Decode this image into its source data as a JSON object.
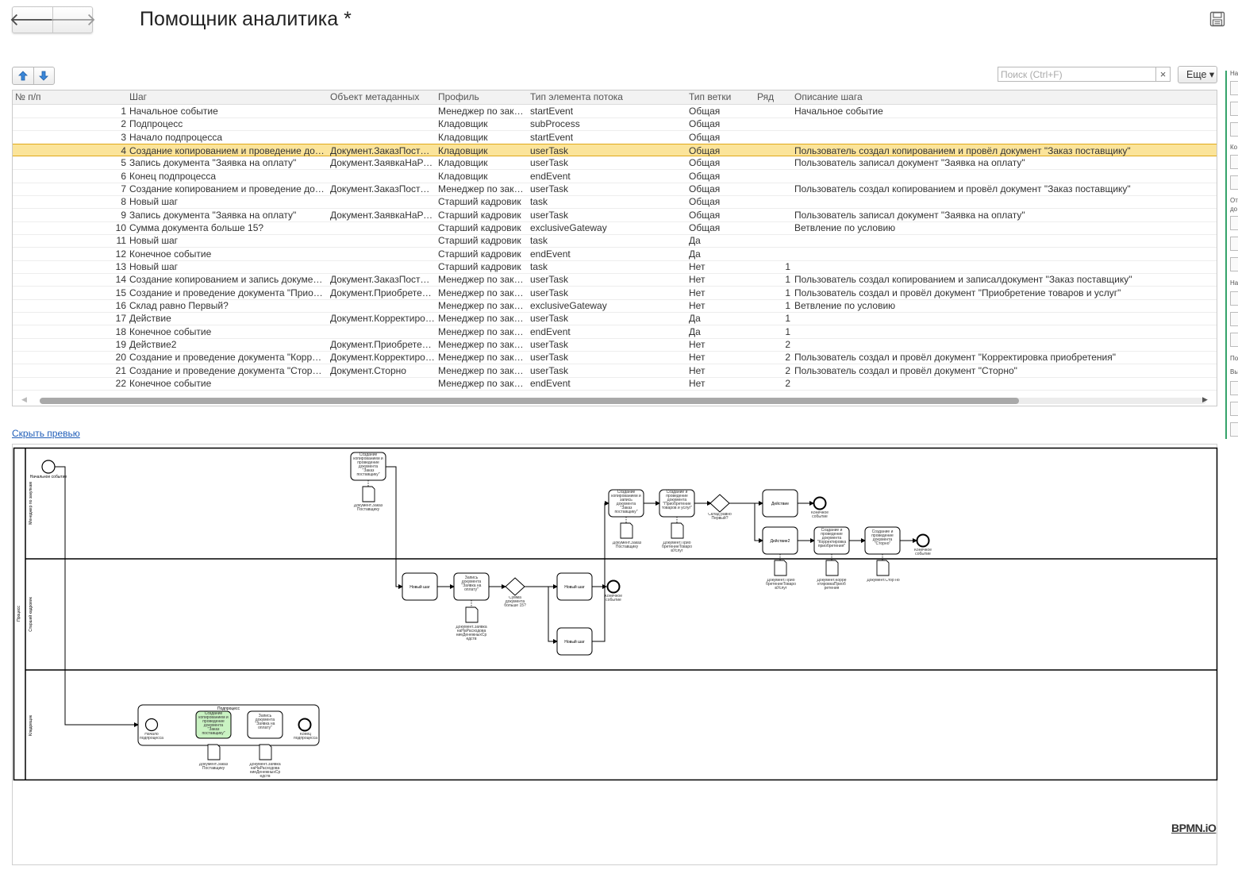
{
  "window": {
    "title": "Помощник аналитика *"
  },
  "nav": {
    "back": "🡐",
    "forward": "🡒"
  },
  "toolbar": {
    "search_placeholder": "Поиск (Ctrl+F)",
    "clear": "×",
    "more_label": "Еще ▾"
  },
  "table": {
    "columns": [
      "№ п/п",
      "Шаг",
      "Объект метаданных",
      "Профиль",
      "Тип элемента потока",
      "Тип ветки",
      "Ряд",
      "Описание шага"
    ],
    "rows": [
      {
        "n": "1",
        "step": "Начальное событие",
        "obj": "",
        "profile": "Менеджер по заку…",
        "type": "startEvent",
        "branch": "Общая",
        "row": "",
        "desc": "Начальное событие"
      },
      {
        "n": "2",
        "step": "Подпроцесс",
        "obj": "",
        "profile": "Кладовщик",
        "type": "subProcess",
        "branch": "Общая",
        "row": "",
        "desc": ""
      },
      {
        "n": "3",
        "step": "Начало подпроцесса",
        "obj": "",
        "profile": "Кладовщик",
        "type": "startEvent",
        "branch": "Общая",
        "row": "",
        "desc": ""
      },
      {
        "n": "4",
        "step": "Создание копированием и проведение доку…",
        "obj": "Документ.ЗаказПостав…",
        "profile": "Кладовщик",
        "type": "userTask",
        "branch": "Общая",
        "row": "",
        "desc": "Пользователь создал копированием и провёл документ \"Заказ поставщику\""
      },
      {
        "n": "5",
        "step": "Запись документа \"Заявка на оплату\"",
        "obj": "Документ.ЗаявкаНаРа…",
        "profile": "Кладовщик",
        "type": "userTask",
        "branch": "Общая",
        "row": "",
        "desc": "Пользователь записал документ \"Заявка на оплату\""
      },
      {
        "n": "6",
        "step": "Конец подпроцесса",
        "obj": "",
        "profile": "Кладовщик",
        "type": "endEvent",
        "branch": "Общая",
        "row": "",
        "desc": ""
      },
      {
        "n": "7",
        "step": "Создание копированием и проведение доку…",
        "obj": "Документ.ЗаказПостав…",
        "profile": "Менеджер по заку…",
        "type": "userTask",
        "branch": "Общая",
        "row": "",
        "desc": "Пользователь создал копированием и провёл документ \"Заказ поставщику\""
      },
      {
        "n": "8",
        "step": "Новый шаг",
        "obj": "",
        "profile": "Старший кадровик",
        "type": "task",
        "branch": "Общая",
        "row": "",
        "desc": ""
      },
      {
        "n": "9",
        "step": "Запись документа \"Заявка на оплату\"",
        "obj": "Документ.ЗаявкаНаРа…",
        "profile": "Старший кадровик",
        "type": "userTask",
        "branch": "Общая",
        "row": "",
        "desc": "Пользователь записал документ \"Заявка на оплату\""
      },
      {
        "n": "10",
        "step": "Сумма документа больше 15?",
        "obj": "",
        "profile": "Старший кадровик",
        "type": "exclusiveGateway",
        "branch": "Общая",
        "row": "",
        "desc": "Ветвление по условию"
      },
      {
        "n": "11",
        "step": "Новый шаг",
        "obj": "",
        "profile": "Старший кадровик",
        "type": "task",
        "branch": "Да",
        "row": "",
        "desc": ""
      },
      {
        "n": "12",
        "step": "Конечное событие",
        "obj": "",
        "profile": "Старший кадровик",
        "type": "endEvent",
        "branch": "Да",
        "row": "",
        "desc": ""
      },
      {
        "n": "13",
        "step": "Новый шаг",
        "obj": "",
        "profile": "Старший кадровик",
        "type": "task",
        "branch": "Нет",
        "row": "1",
        "desc": ""
      },
      {
        "n": "14",
        "step": "Создание копированием и запись документа…",
        "obj": "Документ.ЗаказПостав…",
        "profile": "Менеджер по заку…",
        "type": "userTask",
        "branch": "Нет",
        "row": "1",
        "desc": "Пользователь создал копированием и записалдокумент \"Заказ поставщику\""
      },
      {
        "n": "15",
        "step": "Создание и проведение документа \"Приобре…",
        "obj": "Документ.Приобретен…",
        "profile": "Менеджер по заку…",
        "type": "userTask",
        "branch": "Нет",
        "row": "1",
        "desc": "Пользователь создал и провёл документ \"Приобретение товаров и услуг\""
      },
      {
        "n": "16",
        "step": "Склад равно Первый?",
        "obj": "",
        "profile": "Менеджер по заку…",
        "type": "exclusiveGateway",
        "branch": "Нет",
        "row": "1",
        "desc": "Ветвление по условию"
      },
      {
        "n": "17",
        "step": "Действие",
        "obj": "Документ.Корректиров…",
        "profile": "Менеджер по заку…",
        "type": "userTask",
        "branch": "Да",
        "row": "1",
        "desc": ""
      },
      {
        "n": "18",
        "step": "Конечное событие",
        "obj": "",
        "profile": "Менеджер по заку…",
        "type": "endEvent",
        "branch": "Да",
        "row": "1",
        "desc": ""
      },
      {
        "n": "19",
        "step": "Действие2",
        "obj": "Документ.Приобретен…",
        "profile": "Менеджер по заку…",
        "type": "userTask",
        "branch": "Нет",
        "row": "2",
        "desc": ""
      },
      {
        "n": "20",
        "step": "Создание и проведение документа \"Коррект…",
        "obj": "Документ.Корректиров…",
        "profile": "Менеджер по заку…",
        "type": "userTask",
        "branch": "Нет",
        "row": "2",
        "desc": "Пользователь создал и провёл документ \"Корректировка приобретения\""
      },
      {
        "n": "21",
        "step": "Создание и проведение документа \"Сторно\"",
        "obj": "Документ.Сторно",
        "profile": "Менеджер по заку…",
        "type": "userTask",
        "branch": "Нет",
        "row": "2",
        "desc": "Пользователь создал и провёл документ \"Сторно\""
      },
      {
        "n": "22",
        "step": "Конечное событие",
        "obj": "",
        "profile": "Менеджер по заку…",
        "type": "endEvent",
        "branch": "Нет",
        "row": "2",
        "desc": ""
      }
    ],
    "selected_row": 3
  },
  "preview": {
    "hide_link": "Скрыть превью",
    "logo": "BPMN.iO",
    "pool_label": "Процесс",
    "lanes": [
      "Менеджер по закупкам",
      "Старший кадровик",
      "Кладовщик"
    ],
    "labels": {
      "start": "Начальное событие",
      "t_copy_order": "Создание копированием и проведение документа \"Заказ поставщику\"",
      "doc_order": "Документ.Заказ Поставщику",
      "new_step": "Новый шаг",
      "t_pay": "Запись документа \"Заявка на оплату\"",
      "gw_sum": "Сумма документа больше 15?",
      "doc_pay": "Документ.Заявка наНаРасходова ниеДенежныхСр едств",
      "end": "Конечное событие",
      "t_copy_write": "Создание копированием и запись документа \"Заказ поставщику\"",
      "t_purchase": "Создание и проведение документа \"Приобретение товаров и услуг\"",
      "doc_purchase": "Документ.Прио бретениеТоваро вУслуг",
      "gw_stock": "Склад равно Первый?",
      "action": "Действие",
      "action2": "Действие2",
      "t_adjust": "Создание и проведение документа \"Корректировка приобретения\"",
      "doc_adjust": "Документ.Корре ктировкаПриоб ретения",
      "t_storno": "Создание и проведение документа \"Сторно\"",
      "doc_storno": "Документ.Стор но",
      "subprocess": "Подпроцесс",
      "sub_start": "Начало подпроцесса",
      "sub_end": "Конец подпроцесса"
    }
  },
  "side_panel": {
    "fragments": [
      "На",
      "Ко",
      "От",
      "до",
      "На",
      "По",
      "Вы"
    ]
  },
  "colors": {
    "selection": "#fbe49a",
    "selection_border": "#e0a91a",
    "link": "#1f5db8",
    "highlight_task": "#c9f2c2",
    "accent": "#35a36a"
  }
}
